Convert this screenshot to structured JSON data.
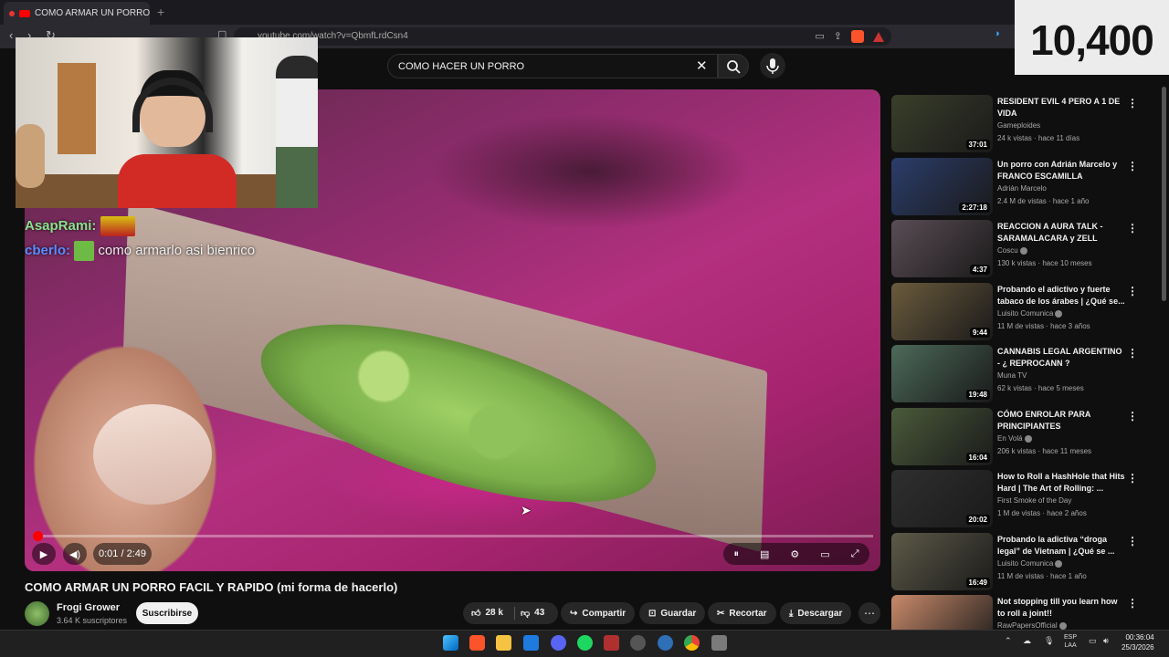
{
  "browser": {
    "tab_title": "COMO ARMAR UN PORRO F",
    "url": "youtube.com/watch?v=QbmfLrdCsn4"
  },
  "counter": "10,400",
  "search": {
    "query": "COMO HACER UN PORRO"
  },
  "chat": [
    {
      "user": "AsapRami:",
      "message": ""
    },
    {
      "user": "cberlo:",
      "message": "como armarlo asi bienrico"
    }
  ],
  "player": {
    "time": "0:01 / 2:49",
    "progress_fraction": 0.006
  },
  "video": {
    "title": "COMO ARMAR UN PORRO FACIL Y RAPIDO (mi forma de hacerlo)",
    "channel": "Frogi Grower",
    "subscribers": "3.64 K suscriptores",
    "subscribe_label": "Suscribirse",
    "likes": "28 k",
    "dislikes": "43",
    "share_label": "Compartir",
    "save_label": "Guardar",
    "clip_label": "Recortar",
    "download_label": "Descargar"
  },
  "recommendations": [
    {
      "title": "RESIDENT EVIL 4 PERO A 1 DE VIDA",
      "channel": "Gameploides",
      "meta": "24 k vistas · hace 11 días",
      "duration": "37:01",
      "verified": false,
      "color": "#3a3f2a"
    },
    {
      "title": "Un porro con Adrián Marcelo y FRANCO ESCAMILLA",
      "channel": "Adrián Marcelo",
      "meta": "2.4 M de vistas · hace 1 año",
      "duration": "2:27:18",
      "verified": false,
      "color": "#2b3d6b"
    },
    {
      "title": "REACCION A AURA TALK - SARAMALACARA y ZELL",
      "channel": "Coscu",
      "meta": "130 k vistas · hace 10 meses",
      "duration": "4:37",
      "verified": true,
      "color": "#5a4d55"
    },
    {
      "title": "Probando el adictivo y fuerte tabaco de los árabes | ¿Qué se...",
      "channel": "Luisito Comunica",
      "meta": "11 M de vistas · hace 3 años",
      "duration": "9:44",
      "verified": true,
      "color": "#6b5b3d"
    },
    {
      "title": "CANNABIS LEGAL ARGENTINO - ¿ REPROCANN ?",
      "channel": "Muna TV",
      "meta": "62 k vistas · hace 5 meses",
      "duration": "19:48",
      "verified": false,
      "color": "#4c6a5a"
    },
    {
      "title": "CÓMO ENROLAR PARA PRINCIPIANTES",
      "channel": "En Volá",
      "meta": "206 k vistas · hace 11 meses",
      "duration": "16:04",
      "verified": true,
      "color": "#4a5a3a"
    },
    {
      "title": "How to Roll a HashHole that Hits Hard | The Art of Rolling: ...",
      "channel": "First Smoke of the Day",
      "meta": "1 M de vistas · hace 2 años",
      "duration": "20:02",
      "verified": false,
      "color": "#2f2f2f"
    },
    {
      "title": "Probando la adictiva “droga legal” de Vietnam | ¿Qué se ...",
      "channel": "Luisito Comunica",
      "meta": "11 M de vistas · hace 1 año",
      "duration": "16:49",
      "verified": true,
      "color": "#5d5a48"
    },
    {
      "title": "Not stopping till you learn how to roll a joint!!",
      "channel": "RawPapersOfficial",
      "meta": "",
      "duration": "",
      "verified": true,
      "color": "#c98a6a"
    }
  ],
  "taskbar": {
    "lang": "ESP",
    "lang_sub": "LAA",
    "time": "00:36:04",
    "date": "25/3/2026"
  }
}
